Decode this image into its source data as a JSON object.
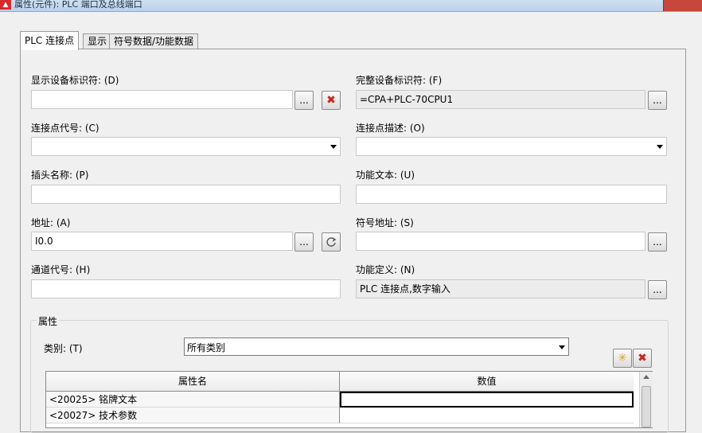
{
  "window": {
    "title": "属性(元件): PLC 端口及总线端口"
  },
  "tabs": [
    {
      "label": "PLC 连接点"
    },
    {
      "label": "显示"
    },
    {
      "label": "符号数据/功能数据"
    }
  ],
  "fields": {
    "display_id": {
      "label": "显示设备标识符: (D)",
      "value": ""
    },
    "full_id": {
      "label": "完整设备标识符: (F)",
      "value": "=CPA+PLC-70CPU1"
    },
    "conn_code": {
      "label": "连接点代号: (C)",
      "value": ""
    },
    "conn_desc": {
      "label": "连接点描述: (O)",
      "value": ""
    },
    "plug_name": {
      "label": "插头名称: (P)",
      "value": ""
    },
    "func_text": {
      "label": "功能文本: (U)",
      "value": ""
    },
    "address": {
      "label": "地址: (A)",
      "value": "I0.0"
    },
    "symbol_addr": {
      "label": "符号地址: (S)",
      "value": ""
    },
    "channel_code": {
      "label": "通道代号: (H)",
      "value": ""
    },
    "func_def": {
      "label": "功能定义: (N)",
      "value": "PLC 连接点,数字输入"
    }
  },
  "buttons": {
    "browse": "..."
  },
  "properties": {
    "group_label": "属性",
    "category_label": "类别: (T)",
    "category_value": "所有类别",
    "columns": [
      "属性名",
      "数值"
    ],
    "rows": [
      {
        "name": "<20025> 铭牌文本",
        "value": ""
      },
      {
        "name": "<20027> 技术参数",
        "value": ""
      }
    ]
  }
}
